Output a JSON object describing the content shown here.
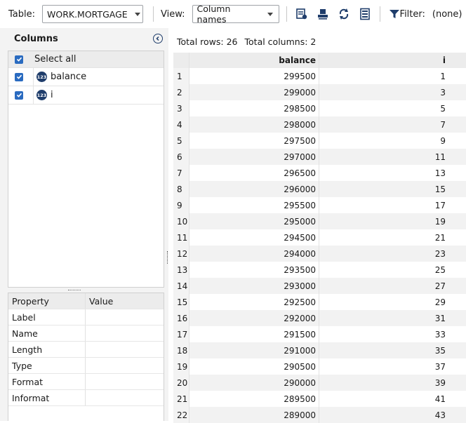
{
  "toolbar": {
    "table_label": "Table:",
    "table_value": "WORK.MORTGAGE",
    "view_label": "View:",
    "view_value": "Column names",
    "filter_label": "Filter:",
    "filter_value": "(none)",
    "icons": [
      "table-properties-icon",
      "save-icon",
      "refresh-icon",
      "columns-icon",
      "filter-icon"
    ]
  },
  "columns_panel": {
    "title": "Columns",
    "select_all": "Select all",
    "columns": [
      {
        "name": "balance",
        "type_badge": "123"
      },
      {
        "name": "i",
        "type_badge": "123"
      }
    ]
  },
  "properties": {
    "headers": [
      "Property",
      "Value"
    ],
    "rows": [
      "Label",
      "Name",
      "Length",
      "Type",
      "Format",
      "Informat"
    ]
  },
  "data_view": {
    "total_rows": "Total rows: 26",
    "total_columns": "Total columns: 2",
    "headers": [
      "balance",
      "i"
    ],
    "rows": [
      [
        "1",
        "299500",
        "1"
      ],
      [
        "2",
        "299000",
        "3"
      ],
      [
        "3",
        "298500",
        "5"
      ],
      [
        "4",
        "298000",
        "7"
      ],
      [
        "5",
        "297500",
        "9"
      ],
      [
        "6",
        "297000",
        "11"
      ],
      [
        "7",
        "296500",
        "13"
      ],
      [
        "8",
        "296000",
        "15"
      ],
      [
        "9",
        "295500",
        "17"
      ],
      [
        "10",
        "295000",
        "19"
      ],
      [
        "11",
        "294500",
        "21"
      ],
      [
        "12",
        "294000",
        "23"
      ],
      [
        "13",
        "293500",
        "25"
      ],
      [
        "14",
        "293000",
        "27"
      ],
      [
        "15",
        "292500",
        "29"
      ],
      [
        "16",
        "292000",
        "31"
      ],
      [
        "17",
        "291500",
        "33"
      ],
      [
        "18",
        "291000",
        "35"
      ],
      [
        "19",
        "290500",
        "37"
      ],
      [
        "20",
        "290000",
        "39"
      ],
      [
        "21",
        "289500",
        "41"
      ],
      [
        "22",
        "289000",
        "43"
      ]
    ]
  },
  "colors": {
    "accent": "#2a6bc0",
    "badge": "#1f3d6b"
  }
}
